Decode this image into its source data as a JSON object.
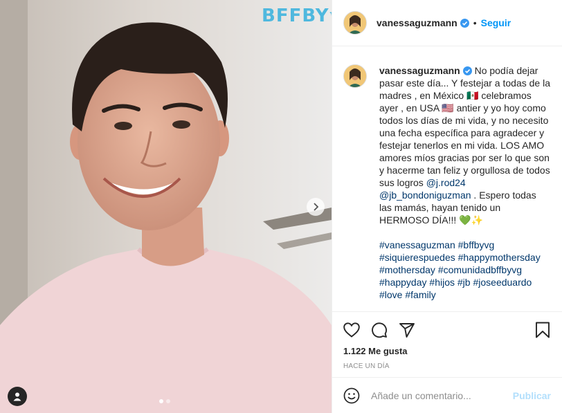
{
  "media": {
    "watermark_main": "BFFBY",
    "watermark_script": "vg",
    "carousel_count": 2,
    "carousel_active": 0
  },
  "header": {
    "username": "vanessaguzmann",
    "separator": "•",
    "follow_label": "Seguir"
  },
  "caption": {
    "username": "vanessaguzmann",
    "text_1": "No podía dejar pasar este día... Y festejar a todas de la madres , en México 🇲🇽 celebramos ayer , en USA 🇺🇸 antier y yo hoy como todos los días de mi vida, y no necesito una fecha específica para agradecer y festejar tenerlos en mi vida. LOS AMO amores míos gracias por ser lo que son y hacerme tan feliz y orgullosa de todos sus logros",
    "mention_1": "@j.rod24",
    "mention_2": "@jb_bondoniguzman",
    "text_2": ". Espero todas las mamás, hayan tenido un HERMOSO DÍA!!! 💚✨",
    "hashtags": [
      "#vanessaguzman",
      "#bffbyvg",
      "#siquierespuedes",
      "#happymothersday",
      "#mothersday",
      "#comunidadbffbyvg",
      "#happyday",
      "#hijos",
      "#jb",
      "#joseeduardo",
      "#love",
      "#family"
    ]
  },
  "actions": {
    "icons": [
      "heart-icon",
      "comment-icon",
      "share-icon",
      "bookmark-icon"
    ]
  },
  "likes": {
    "count": "1.122",
    "label": "Me gusta"
  },
  "timestamp": "HACE UN DÍA",
  "comment_box": {
    "placeholder": "Añade un comentario...",
    "publish_label": "Publicar"
  },
  "colors": {
    "accent": "#0095f6",
    "link": "#00376b",
    "watermark": "#4fb8de",
    "publish_disabled": "#b2dffc",
    "shirt": "#f0d4d6"
  }
}
